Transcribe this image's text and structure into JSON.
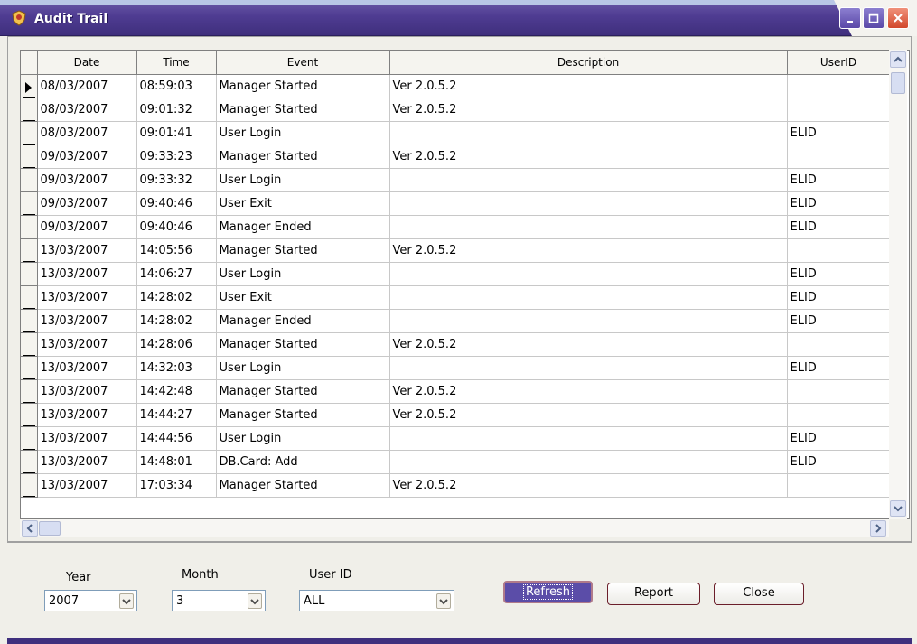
{
  "window": {
    "title": "Audit Trail"
  },
  "grid": {
    "columns": [
      "Date",
      "Time",
      "Event",
      "Description",
      "UserID"
    ],
    "rows": [
      {
        "date": "08/03/2007",
        "time": "08:59:03",
        "event": "Manager Started",
        "description": "Ver 2.0.5.2",
        "userid": ""
      },
      {
        "date": "08/03/2007",
        "time": "09:01:32",
        "event": "Manager Started",
        "description": "Ver 2.0.5.2",
        "userid": ""
      },
      {
        "date": "08/03/2007",
        "time": "09:01:41",
        "event": "User Login",
        "description": "",
        "userid": "ELID"
      },
      {
        "date": "09/03/2007",
        "time": "09:33:23",
        "event": "Manager Started",
        "description": "Ver 2.0.5.2",
        "userid": ""
      },
      {
        "date": "09/03/2007",
        "time": "09:33:32",
        "event": "User Login",
        "description": "",
        "userid": "ELID"
      },
      {
        "date": "09/03/2007",
        "time": "09:40:46",
        "event": "User Exit",
        "description": "",
        "userid": "ELID"
      },
      {
        "date": "09/03/2007",
        "time": "09:40:46",
        "event": "Manager Ended",
        "description": "",
        "userid": "ELID"
      },
      {
        "date": "13/03/2007",
        "time": "14:05:56",
        "event": "Manager Started",
        "description": "Ver 2.0.5.2",
        "userid": ""
      },
      {
        "date": "13/03/2007",
        "time": "14:06:27",
        "event": "User Login",
        "description": "",
        "userid": "ELID"
      },
      {
        "date": "13/03/2007",
        "time": "14:28:02",
        "event": "User Exit",
        "description": "",
        "userid": "ELID"
      },
      {
        "date": "13/03/2007",
        "time": "14:28:02",
        "event": "Manager Ended",
        "description": "",
        "userid": "ELID"
      },
      {
        "date": "13/03/2007",
        "time": "14:28:06",
        "event": "Manager Started",
        "description": "Ver 2.0.5.2",
        "userid": ""
      },
      {
        "date": "13/03/2007",
        "time": "14:32:03",
        "event": "User Login",
        "description": "",
        "userid": "ELID"
      },
      {
        "date": "13/03/2007",
        "time": "14:42:48",
        "event": "Manager Started",
        "description": "Ver 2.0.5.2",
        "userid": ""
      },
      {
        "date": "13/03/2007",
        "time": "14:44:27",
        "event": "Manager Started",
        "description": "Ver 2.0.5.2",
        "userid": ""
      },
      {
        "date": "13/03/2007",
        "time": "14:44:56",
        "event": "User Login",
        "description": "",
        "userid": "ELID"
      },
      {
        "date": "13/03/2007",
        "time": "14:48:01",
        "event": "DB.Card: Add",
        "description": "",
        "userid": "ELID"
      },
      {
        "date": "13/03/2007",
        "time": "17:03:34",
        "event": "Manager Started",
        "description": "Ver 2.0.5.2",
        "userid": ""
      }
    ]
  },
  "filters": {
    "year": {
      "label": "Year",
      "value": "2007"
    },
    "month": {
      "label": "Month",
      "value": "3"
    },
    "userid": {
      "label": "User ID",
      "value": "ALL"
    }
  },
  "buttons": {
    "refresh": "Refresh",
    "report": "Report",
    "close": "Close"
  },
  "colors": {
    "titlebar": "#4f3c92",
    "active_button": "#5b4da8",
    "close_button": "#d2482c"
  },
  "icons": {
    "app": "shield-icon",
    "minimize": "minimize-icon",
    "maximize": "maximize-icon",
    "close": "close-icon"
  }
}
